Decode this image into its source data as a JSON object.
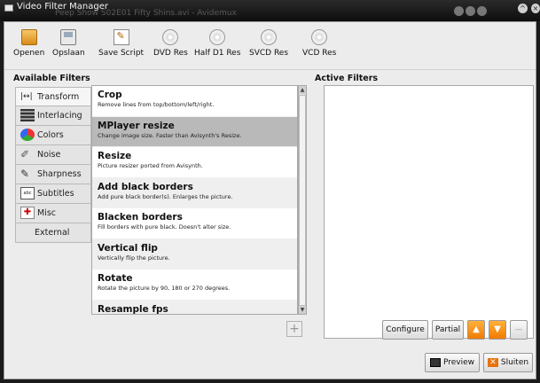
{
  "window": {
    "title": "Video Filter Manager",
    "background_title": "Peep Show S02E01 Fifty Shins.avi - Avidemux"
  },
  "toolbar": {
    "open": "Openen",
    "save": "Opslaan",
    "save_script": "Save Script",
    "dvd_res": "DVD Res",
    "half_d1_res": "Half D1 Res",
    "svcd_res": "SVCD Res",
    "vcd_res": "VCD Res"
  },
  "available_filters_label": "Available Filters",
  "active_filters_label": "Active Filters",
  "categories": [
    {
      "label": "Transform",
      "icon": "transform-icon"
    },
    {
      "label": "Interlacing",
      "icon": "interlacing-icon"
    },
    {
      "label": "Colors",
      "icon": "colors-icon"
    },
    {
      "label": "Noise",
      "icon": "noise-icon"
    },
    {
      "label": "Sharpness",
      "icon": "sharpness-icon"
    },
    {
      "label": "Subtitles",
      "icon": "subtitles-icon"
    },
    {
      "label": "Misc",
      "icon": "misc-icon"
    },
    {
      "label": "External",
      "icon": ""
    }
  ],
  "filters": [
    {
      "name": "Crop",
      "desc": "Remove lines from top/bottom/left/right."
    },
    {
      "name": "MPlayer resize",
      "desc": "Change image size. Faster than Avisynth's Resize."
    },
    {
      "name": "Resize",
      "desc": "Picture resizer ported from Avisynth."
    },
    {
      "name": "Add black borders",
      "desc": "Add pure black border(s). Enlarges the picture."
    },
    {
      "name": "Blacken borders",
      "desc": "Fill borders with pure black. Doesn't alter size."
    },
    {
      "name": "Vertical flip",
      "desc": "Vertically flip the picture."
    },
    {
      "name": "Rotate",
      "desc": "Rotate the picture by 90, 180 or 270 degrees."
    },
    {
      "name": "Resample fps",
      "desc": ""
    }
  ],
  "buttons": {
    "configure": "Configure",
    "partial": "Partial",
    "preview": "Preview",
    "close": "Sluiten",
    "add": "+"
  }
}
